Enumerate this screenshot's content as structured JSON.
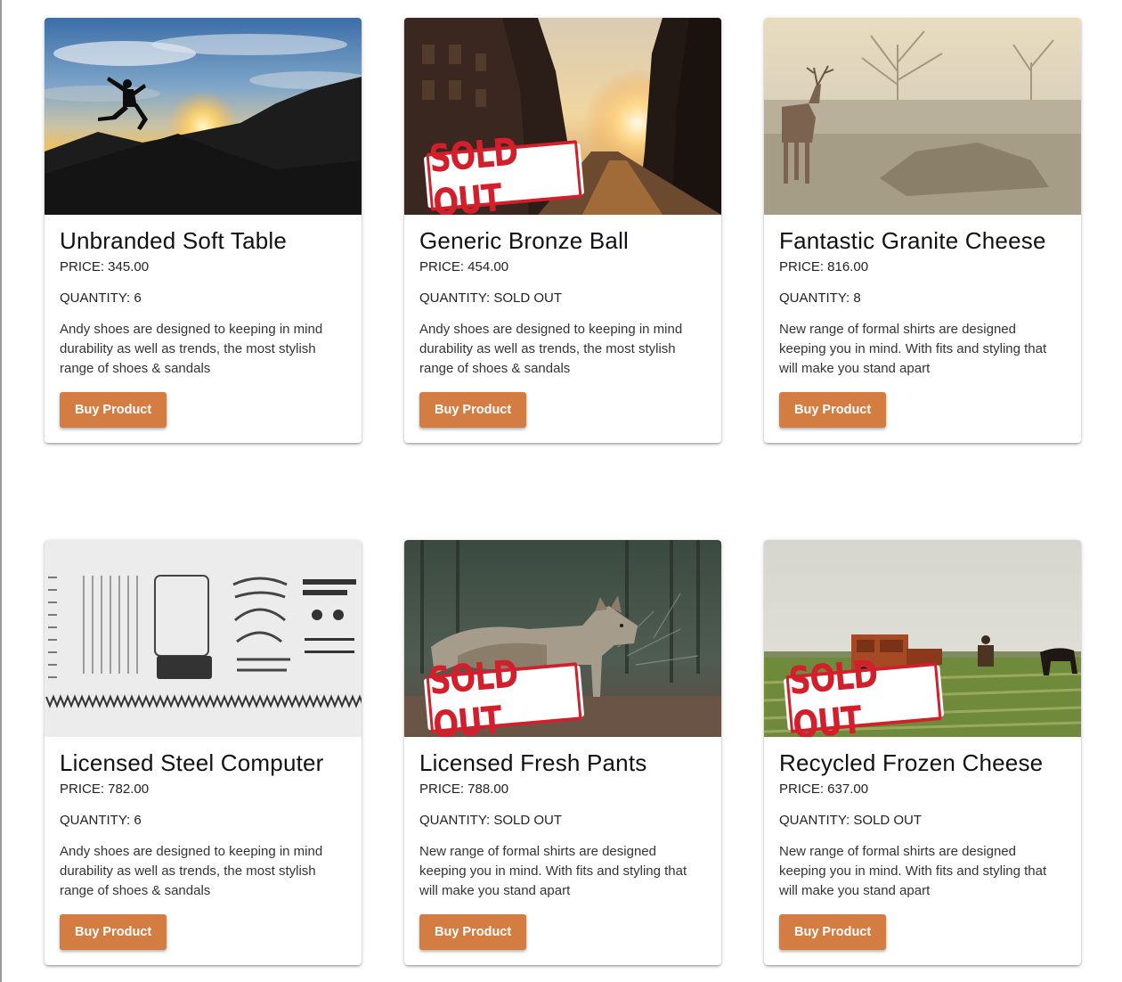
{
  "products": [
    {
      "name": "Unbranded Soft Table",
      "price_text": "PRICE: 345.00",
      "quantity_text": "QUANTITY: 6",
      "description": "Andy shoes are designed to keeping in mind durability as well as trends, the most stylish range of shoes & sandals",
      "button_label": "Buy Product",
      "image": "sunset-jumper-photo",
      "sold_out": false
    },
    {
      "name": "Generic Bronze Ball",
      "price_text": "PRICE: 454.00",
      "quantity_text": "QUANTITY: SOLD OUT",
      "description": "Andy shoes are designed to keeping in mind durability as well as trends, the most stylish range of shoes & sandals",
      "button_label": "Buy Product",
      "image": "city-street-sunset-photo",
      "sold_out": true,
      "stamp_text": "SOLD OUT"
    },
    {
      "name": "Fantastic Granite Cheese",
      "price_text": "PRICE: 816.00",
      "quantity_text": "QUANTITY: 8",
      "description": "New range of formal shirts are designed keeping you in mind. With fits and styling that will make you stand apart",
      "button_label": "Buy Product",
      "image": "deer-in-field-photo",
      "sold_out": false
    },
    {
      "name": "Licensed Steel Computer",
      "price_text": "PRICE: 782.00",
      "quantity_text": "QUANTITY: 6",
      "description": "Andy shoes are designed to keeping in mind durability as well as trends, the most stylish range of shoes & sandals",
      "button_label": "Buy Product",
      "image": "typewriter-parts-photo",
      "sold_out": false
    },
    {
      "name": "Licensed Fresh Pants",
      "price_text": "PRICE: 788.00",
      "quantity_text": "QUANTITY: SOLD OUT",
      "description": "New range of formal shirts are designed keeping you in mind. With fits and styling that will make you stand apart",
      "button_label": "Buy Product",
      "image": "coyote-photo",
      "sold_out": true,
      "stamp_text": "SOLD OUT"
    },
    {
      "name": "Recycled Frozen Cheese",
      "price_text": "PRICE: 637.00",
      "quantity_text": "QUANTITY: SOLD OUT",
      "description": "New range of formal shirts are designed keeping you in mind. With fits and styling that will make you stand apart",
      "button_label": "Buy Product",
      "image": "farm-harvester-photo",
      "sold_out": true,
      "stamp_text": "SOLD OUT"
    }
  ],
  "colors": {
    "button": "#d47d42",
    "stamp": "#d31f2b"
  }
}
